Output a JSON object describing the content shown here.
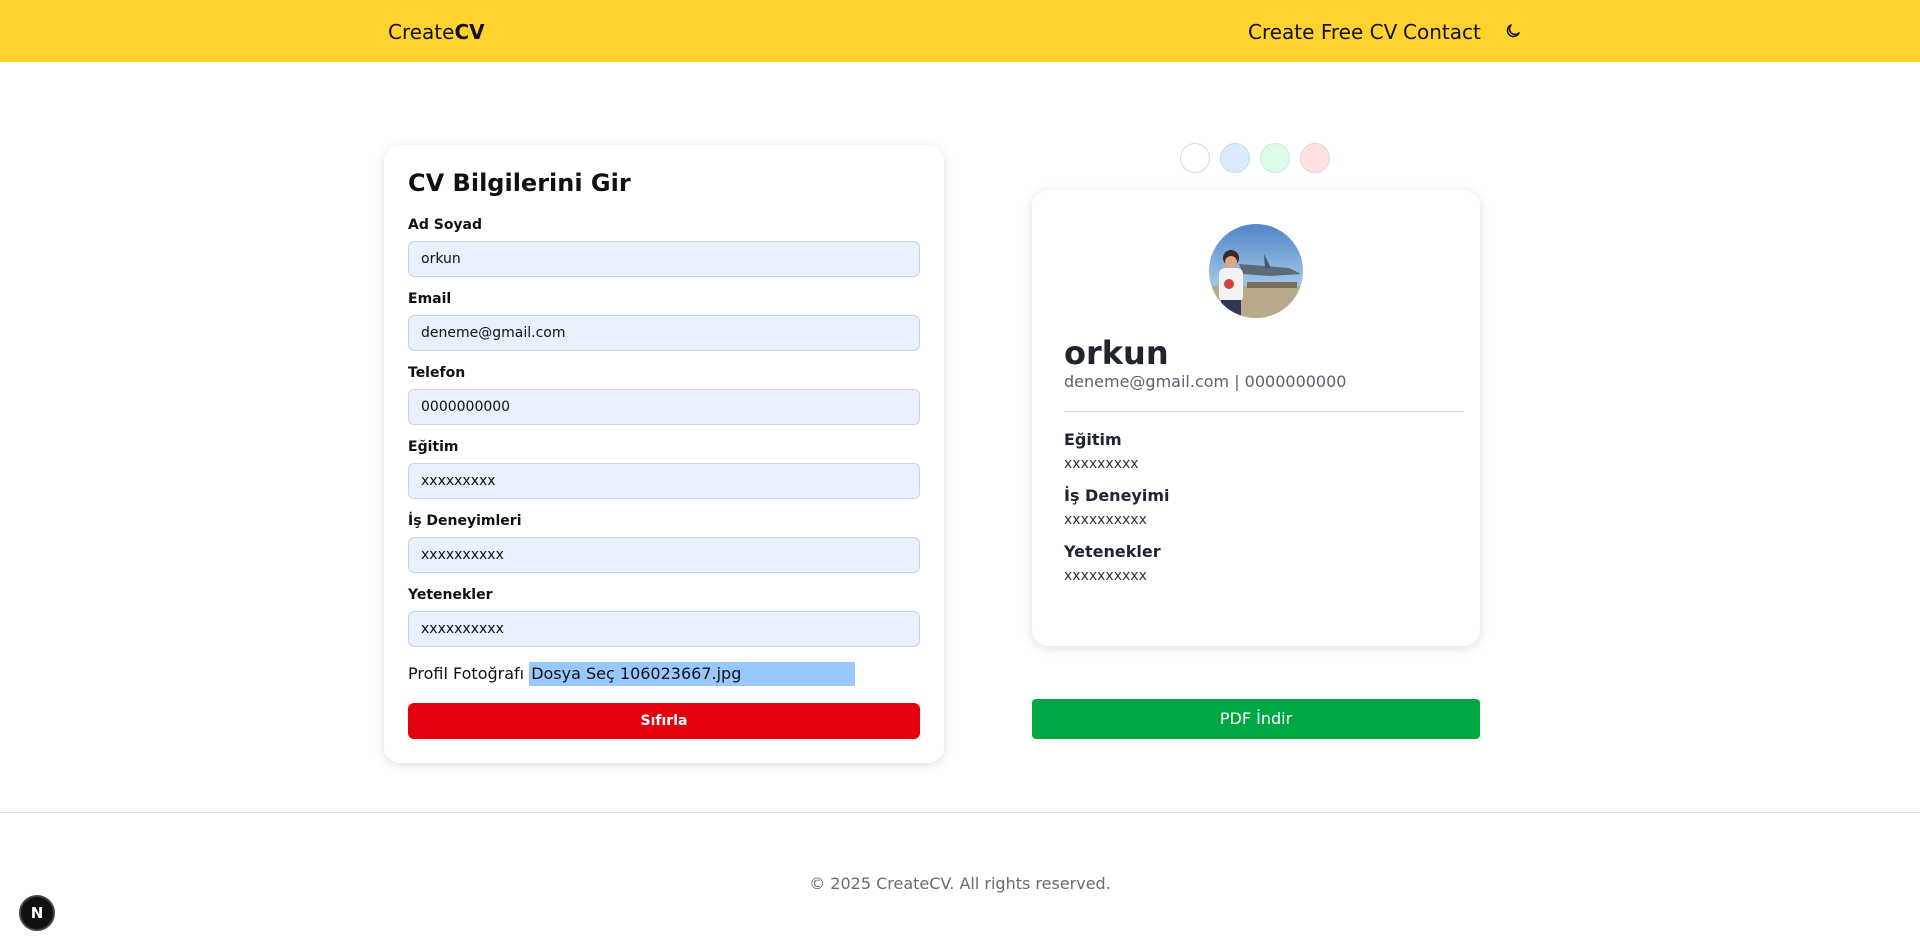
{
  "header": {
    "brand_prefix": "Create",
    "brand_bold": "CV",
    "nav": {
      "create_free_cv": "Create Free CV",
      "contact": "Contact"
    },
    "theme_toggle_icon": "moon-icon",
    "background": "#ffd22e"
  },
  "form": {
    "title": "CV Bilgilerini Gir",
    "fields": {
      "name": {
        "label": "Ad Soyad",
        "value": "orkun"
      },
      "email": {
        "label": "Email",
        "value": "deneme@gmail.com"
      },
      "phone": {
        "label": "Telefon",
        "value": "0000000000"
      },
      "education": {
        "label": "Eğitim",
        "value": "xxxxxxxxx"
      },
      "experience": {
        "label": "İş Deneyimleri",
        "value": "xxxxxxxxxx"
      },
      "skills": {
        "label": "Yetenekler",
        "value": "xxxxxxxxxx"
      }
    },
    "photo": {
      "label": "Profil Fotoğrafı",
      "button": "Dosya Seç",
      "filename": "106023667.jpg"
    },
    "reset_label": "Sıfırla",
    "input_bg": "#e8f0fe",
    "reset_color": "#e4000f"
  },
  "theme_swatches": [
    {
      "name": "white",
      "color": "#ffffff"
    },
    {
      "name": "blue",
      "color": "#dbeafe"
    },
    {
      "name": "green",
      "color": "#dcfce7"
    },
    {
      "name": "red",
      "color": "#fee2e2"
    }
  ],
  "preview": {
    "name": "orkun",
    "contact": "deneme@gmail.com | 0000000000",
    "sections": {
      "education": {
        "title": "Eğitim",
        "value": "xxxxxxxxx"
      },
      "experience": {
        "title": "İş Deneyimi",
        "value": "xxxxxxxxxx"
      },
      "skills": {
        "title": "Yetenekler",
        "value": "xxxxxxxxxx"
      }
    }
  },
  "pdf_label": "PDF İndir",
  "pdf_color": "#00a843",
  "footer": {
    "copyright": "© 2025 CreateCV. All rights reserved."
  },
  "dev_badge": "N"
}
